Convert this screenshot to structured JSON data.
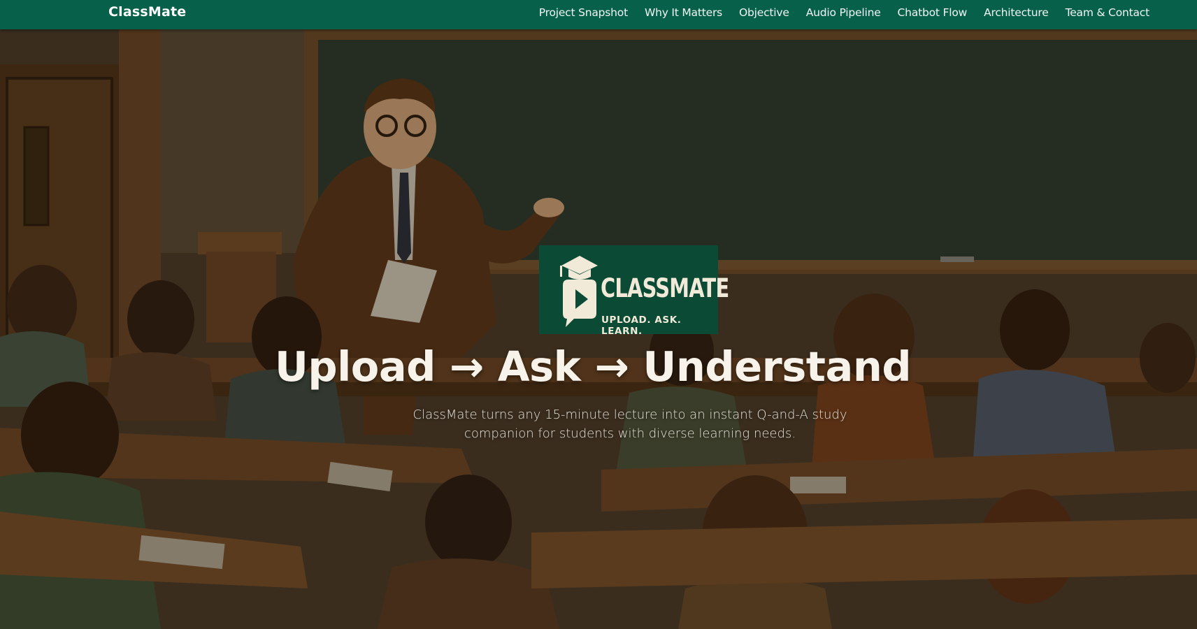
{
  "nav": {
    "brand": "ClassMate",
    "links": [
      "Project Snapshot",
      "Why It Matters",
      "Objective",
      "Audio Pipeline",
      "Chatbot Flow",
      "Architecture",
      "Team & Contact"
    ]
  },
  "hero": {
    "logo_word": "CLASSMATE",
    "logo_tagline": "UPLOAD. ASK. LEARN.",
    "title": "Upload → Ask → Understand",
    "subtitle": "ClassMate turns any 15-minute lecture into an instant Q-and-A study companion for students with diverse learning needs."
  },
  "colors": {
    "nav_bg": "#07614a",
    "logo_bg": "#0b4a35",
    "chalkboard": "#2c3a2e",
    "text_light": "#f7f3ea"
  },
  "icons": {
    "logo": "graduation-cap-play-bubble-icon"
  }
}
